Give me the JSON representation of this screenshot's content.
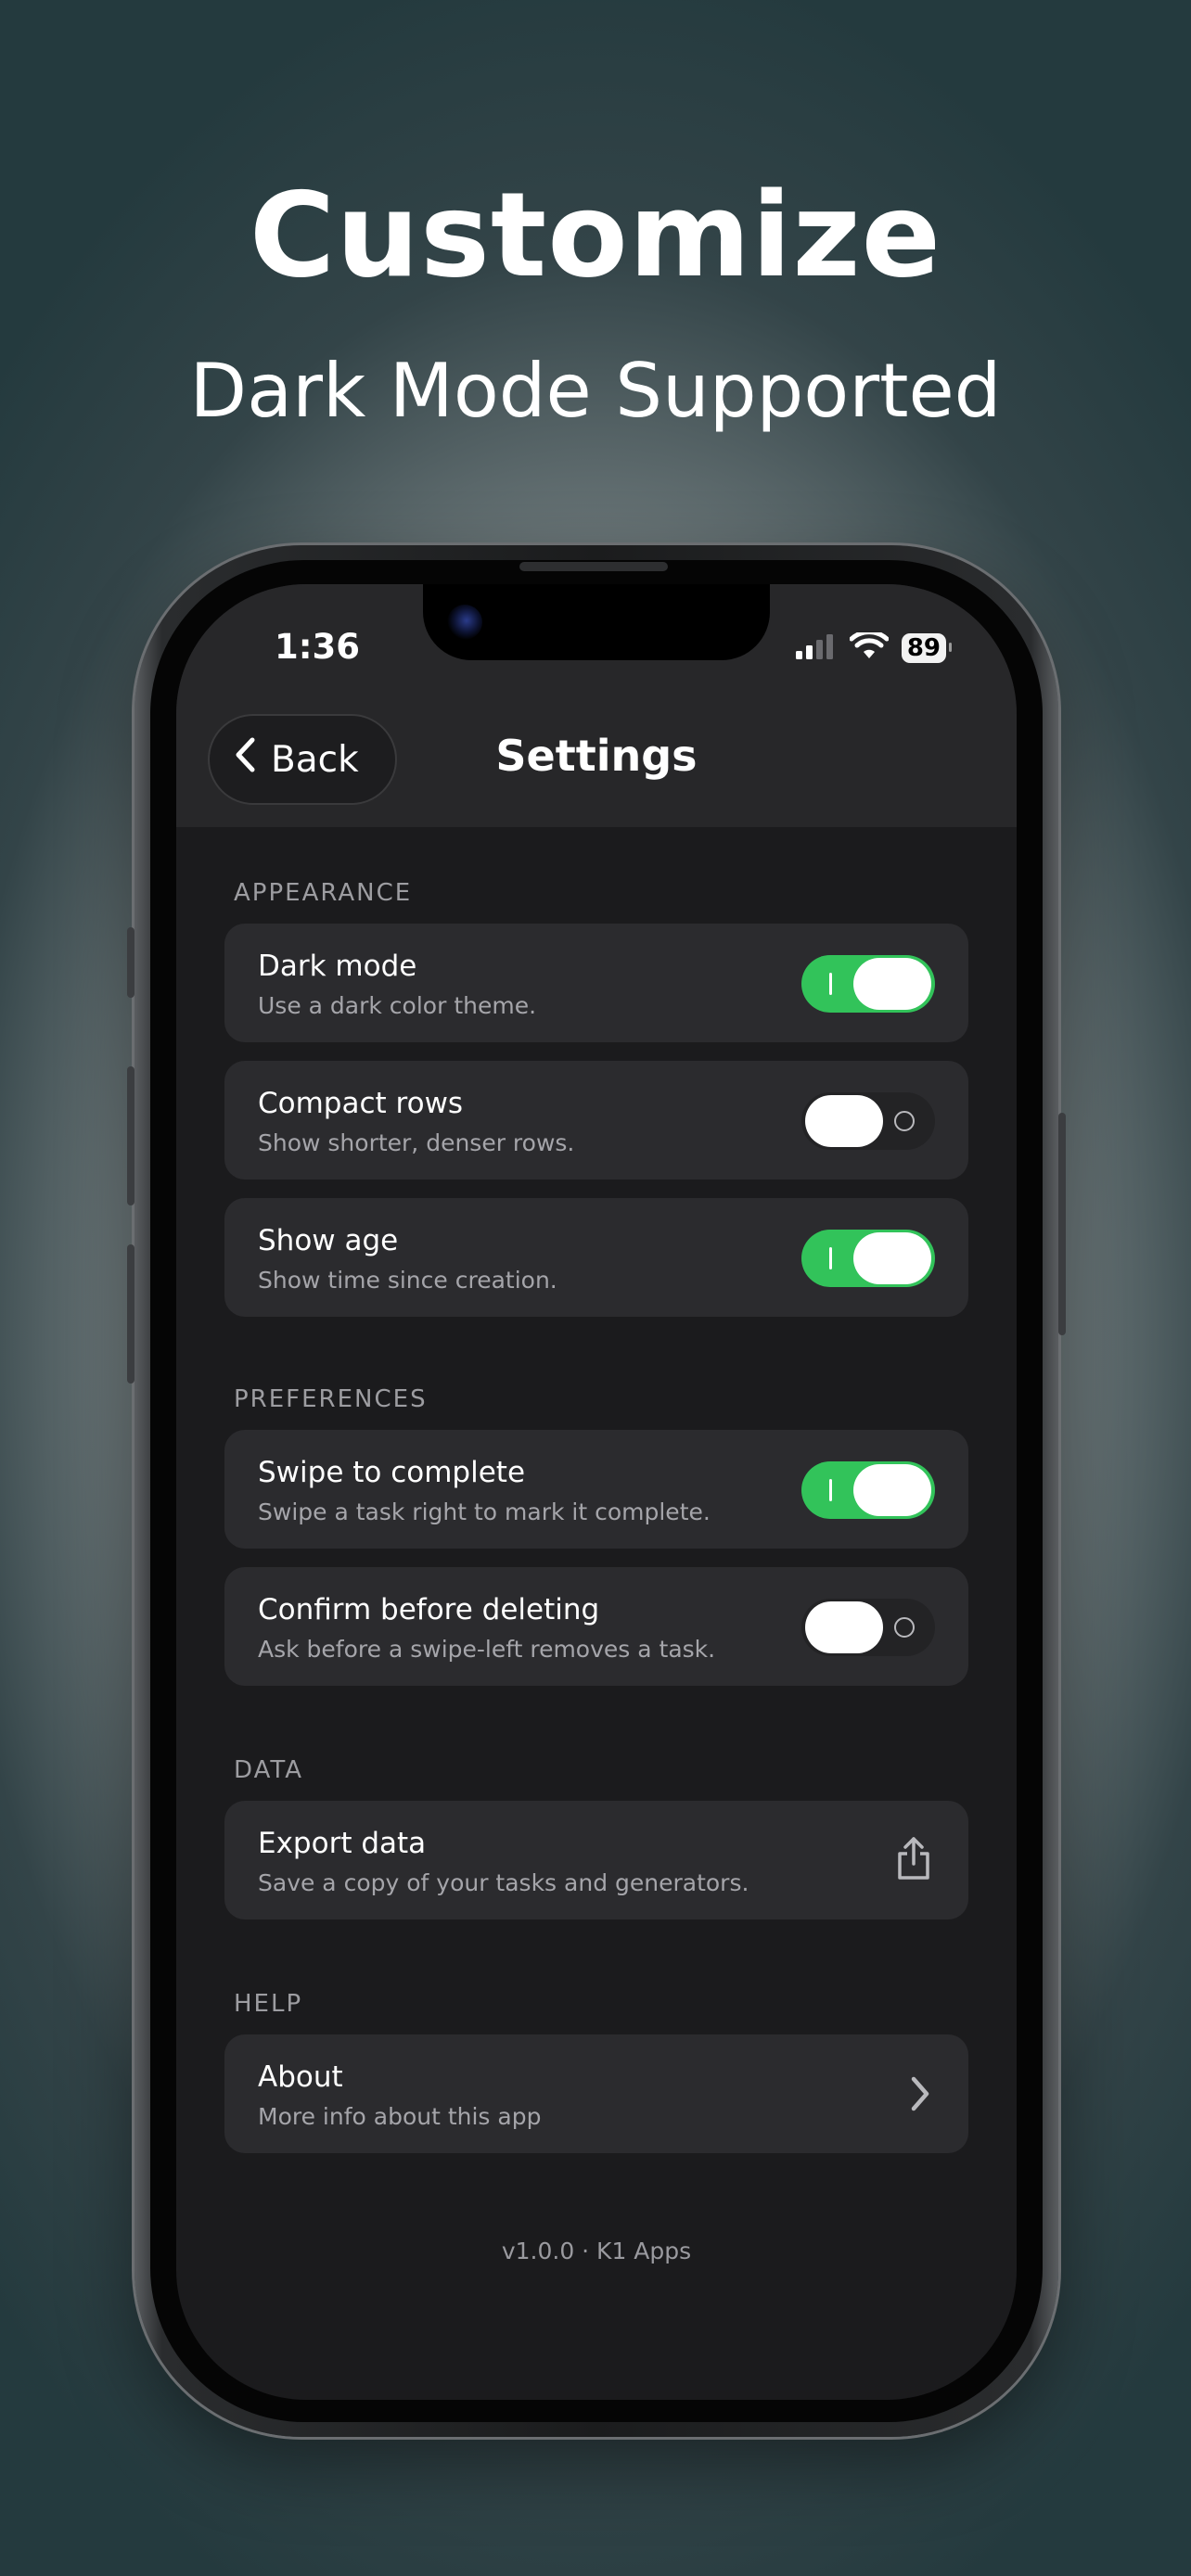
{
  "promo": {
    "headline": "Customize",
    "subheadline": "Dark Mode Supported"
  },
  "status_bar": {
    "time": "1:36",
    "battery": "89"
  },
  "nav": {
    "back_label": "Back",
    "title": "Settings"
  },
  "sections": [
    {
      "label": "APPEARANCE",
      "items": [
        {
          "title": "Dark mode",
          "description": "Use a dark color theme.",
          "control": "toggle",
          "enabled": true
        },
        {
          "title": "Compact rows",
          "description": "Show shorter, denser rows.",
          "control": "toggle",
          "enabled": false
        },
        {
          "title": "Show age",
          "description": "Show time since creation.",
          "control": "toggle",
          "enabled": true
        }
      ]
    },
    {
      "label": "PREFERENCES",
      "items": [
        {
          "title": "Swipe to complete",
          "description": "Swipe a task right to mark it complete.",
          "control": "toggle",
          "enabled": true
        },
        {
          "title": "Confirm before deleting",
          "description": "Ask before a swipe-left removes a task.",
          "control": "toggle",
          "enabled": false
        }
      ]
    },
    {
      "label": "DATA",
      "items": [
        {
          "title": "Export data",
          "description": "Save a copy of your tasks and generators.",
          "control": "share-icon"
        }
      ]
    },
    {
      "label": "HELP",
      "items": [
        {
          "title": "About",
          "description": "More info about this app",
          "control": "chevron-right-icon"
        }
      ]
    }
  ],
  "footer": {
    "version": "v1.0.0 · K1 Apps"
  },
  "colors": {
    "toggle_on": "#32c35a",
    "card_background": "#2b2b2e",
    "screen_background": "#1b1b1d",
    "nav_background": "#272729"
  }
}
